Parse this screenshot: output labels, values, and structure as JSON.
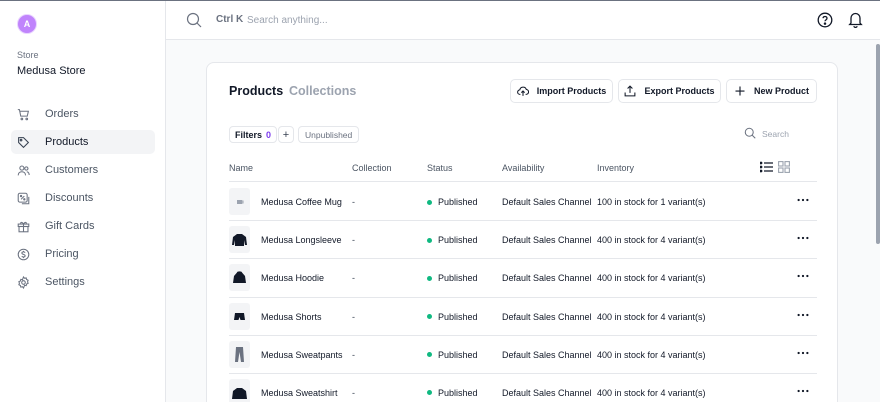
{
  "sidebar": {
    "avatar_initial": "A",
    "store_caption": "Store",
    "store_name": "Medusa Store",
    "items": [
      {
        "label": "Orders",
        "icon": "cart-icon",
        "active": false
      },
      {
        "label": "Products",
        "icon": "tag-icon",
        "active": true
      },
      {
        "label": "Customers",
        "icon": "users-icon",
        "active": false
      },
      {
        "label": "Discounts",
        "icon": "discount-icon",
        "active": false
      },
      {
        "label": "Gift Cards",
        "icon": "gift-icon",
        "active": false
      },
      {
        "label": "Pricing",
        "icon": "dollar-icon",
        "active": false
      },
      {
        "label": "Settings",
        "icon": "gear-icon",
        "active": false
      }
    ]
  },
  "topbar": {
    "shortcut": "Ctrl K",
    "search_placeholder": "Search anything...",
    "help_icon": "help-icon",
    "bell_icon": "bell-icon"
  },
  "products": {
    "tabs": [
      {
        "label": "Products",
        "active": true
      },
      {
        "label": "Collections",
        "active": false
      }
    ],
    "buttons": {
      "import_label": "Import Products",
      "export_label": "Export Products",
      "new_label": "New Product"
    },
    "filters": {
      "label": "Filters",
      "count": "0",
      "add": "+",
      "chip": "Unpublished"
    },
    "search_placeholder": "Search",
    "columns": [
      "Name",
      "Collection",
      "Status",
      "Availability",
      "Inventory"
    ],
    "rows": [
      {
        "name": "Medusa Coffee Mug",
        "collection": "-",
        "status": "Published",
        "availability": "Default Sales Channel",
        "inventory": "100 in stock for 1 variant(s)",
        "thumb": "mug-thumbnail-icon"
      },
      {
        "name": "Medusa Longsleeve",
        "collection": "-",
        "status": "Published",
        "availability": "Default Sales Channel",
        "inventory": "400 in stock for 4 variant(s)",
        "thumb": "longsleeve-thumbnail-icon"
      },
      {
        "name": "Medusa Hoodie",
        "collection": "-",
        "status": "Published",
        "availability": "Default Sales Channel",
        "inventory": "400 in stock for 4 variant(s)",
        "thumb": "hoodie-thumbnail-icon"
      },
      {
        "name": "Medusa Shorts",
        "collection": "-",
        "status": "Published",
        "availability": "Default Sales Channel",
        "inventory": "400 in stock for 4 variant(s)",
        "thumb": "shorts-thumbnail-icon"
      },
      {
        "name": "Medusa Sweatpants",
        "collection": "-",
        "status": "Published",
        "availability": "Default Sales Channel",
        "inventory": "400 in stock for 4 variant(s)",
        "thumb": "sweatpants-thumbnail-icon"
      },
      {
        "name": "Medusa Sweatshirt",
        "collection": "-",
        "status": "Published",
        "availability": "Default Sales Channel",
        "inventory": "400 in stock for 4 variant(s)",
        "thumb": "sweatshirt-thumbnail-icon"
      }
    ]
  },
  "colors": {
    "accent": "#7c3aed",
    "status_published": "#10b981",
    "avatar": "#c084fc"
  }
}
